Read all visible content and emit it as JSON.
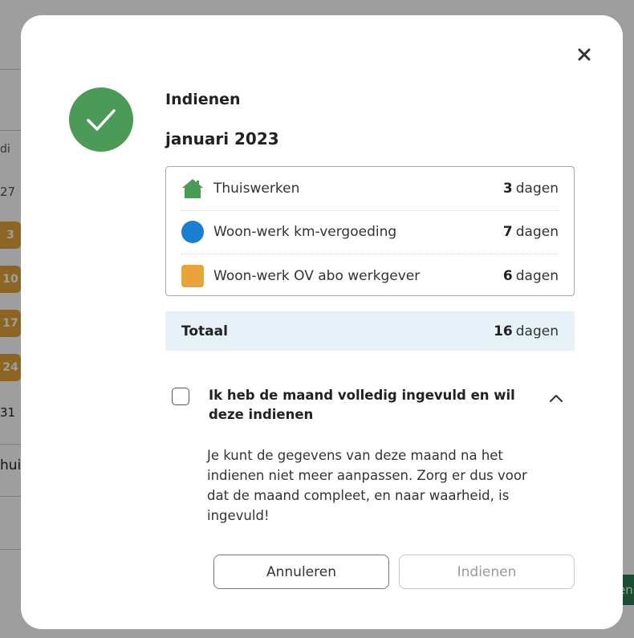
{
  "background": {
    "col_header": "di",
    "day_27": "27",
    "badges": [
      "3",
      "10",
      "17",
      "24"
    ],
    "day_31": "31",
    "row_label": "huis",
    "right_button": "en"
  },
  "dialog": {
    "close_icon": "close-icon",
    "success_icon": "check-circle-icon",
    "title": "Indienen",
    "month": "januari 2023",
    "items": [
      {
        "icon": "house-icon",
        "color": "#4c9a57",
        "label": "Thuiswerken",
        "count": "3",
        "unit": "dagen"
      },
      {
        "icon": "blue-circle-icon",
        "color": "#1a7fd0",
        "label": "Woon-werk km-vergoeding",
        "count": "7",
        "unit": "dagen"
      },
      {
        "icon": "orange-square-icon",
        "color": "#e8a33c",
        "label": "Woon-werk OV abo werkgever",
        "count": "6",
        "unit": "dagen"
      }
    ],
    "total": {
      "label": "Totaal",
      "count": "16",
      "unit": "dagen"
    },
    "confirm_label": "Ik heb de maand volledig ingevuld en wil deze indienen",
    "description": "Je kunt de gegevens van deze maand na het indienen niet meer aanpassen. Zorg er dus voor dat de maand compleet, en naar waarheid, is ingevuld!",
    "cancel_label": "Annuleren",
    "submit_label": "Indienen",
    "accent_color": "#4c9a57"
  }
}
